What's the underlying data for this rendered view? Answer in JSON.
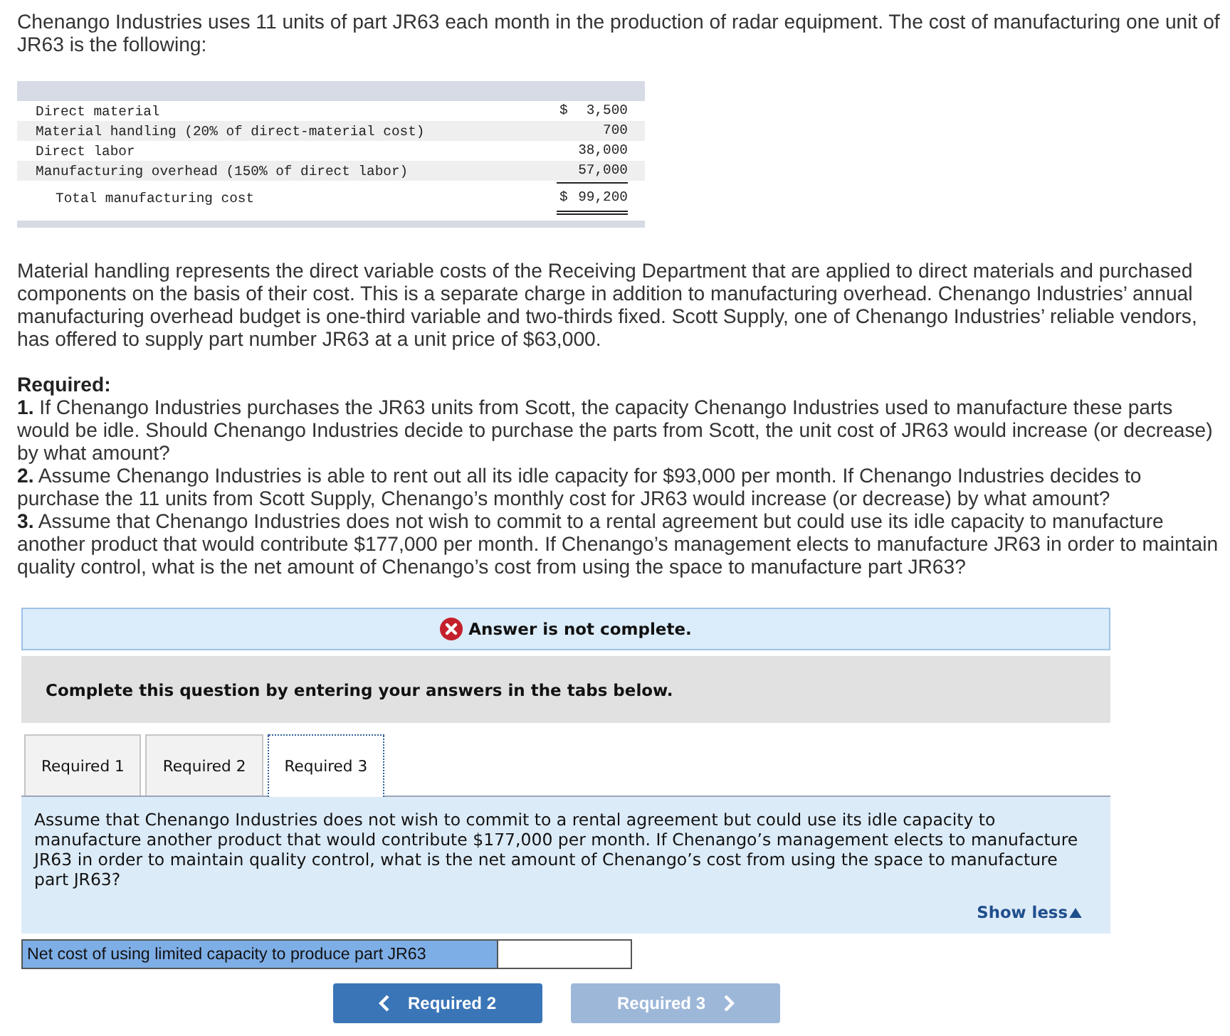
{
  "intro": "Chenango Industries uses 11 units of part JR63 each month in the production of radar equipment. The cost of manufacturing one unit of JR63 is the following:",
  "cost_table": {
    "rows": [
      {
        "kind": "item",
        "label": "Direct material",
        "currency": "$",
        "amount": "3,500"
      },
      {
        "kind": "item",
        "label": "Material handling (20% of direct-material cost)",
        "amount": "700"
      },
      {
        "kind": "item",
        "label": "Direct labor",
        "amount": "38,000"
      },
      {
        "kind": "item",
        "label": "Manufacturing overhead (150% of direct labor)",
        "amount": "57,000"
      },
      {
        "kind": "total",
        "label": "Total manufacturing cost",
        "currency": "$",
        "amount": "99,200"
      }
    ]
  },
  "description": "Material handling represents the direct variable costs of the Receiving Department that are applied to direct materials and purchased components on the basis of their cost. This is a separate charge in addition to manufacturing overhead. Chenango Industries’ annual manufacturing overhead budget is one-third variable and two-thirds fixed. Scott Supply, one of Chenango Industries’ reliable vendors, has offered to supply part number JR63 at a unit price of $63,000.",
  "required": {
    "heading": "Required:",
    "items": [
      "**1.** If Chenango Industries purchases the JR63 units from Scott, the capacity Chenango Industries used to manufacture these parts would be idle. Should Chenango Industries decide to purchase the parts from Scott, the unit cost of JR63 would increase (or decrease) by what amount?",
      "**2.** Assume Chenango Industries is able to rent out all its idle capacity for $93,000 per month. If Chenango Industries decides to purchase the 11 units from Scott Supply, Chenango’s monthly cost for JR63 would increase (or decrease) by what amount?",
      "**3.** Assume that Chenango Industries does not wish to commit to a rental agreement but could use its idle capacity to manufacture another product that would contribute $177,000 per month. If Chenango’s management elects to manufacture JR63 in order to maintain quality control, what is the net amount of Chenango’s cost from using the space to manufacture part JR63?"
    ]
  },
  "status": {
    "complete": false,
    "text": "Answer is not complete."
  },
  "instruction": "Complete this question by entering your answers in the tabs below.",
  "tabs": [
    {
      "label": "Required 1",
      "selected": false
    },
    {
      "label": "Required 2",
      "selected": false
    },
    {
      "label": "Required 3",
      "selected": true
    }
  ],
  "question": {
    "text": "Assume that Chenango Industries does not wish to commit to a rental agreement but could use its idle capacity to manufacture another product that would contribute $177,000 per month. If Chenango’s management elects to manufacture JR63 in order to maintain quality control, what is the net amount of Chenango’s cost from using the space to manufacture part JR63?",
    "toggle": "Show less",
    "expanded": true
  },
  "answer_row": {
    "label": "Net cost of using limited capacity to produce part JR63"
  },
  "nav_buttons": [
    {
      "kind": "previous",
      "label": "Required 2",
      "disabled": false
    },
    {
      "kind": "next",
      "label": "Required 3",
      "disabled": true
    }
  ]
}
